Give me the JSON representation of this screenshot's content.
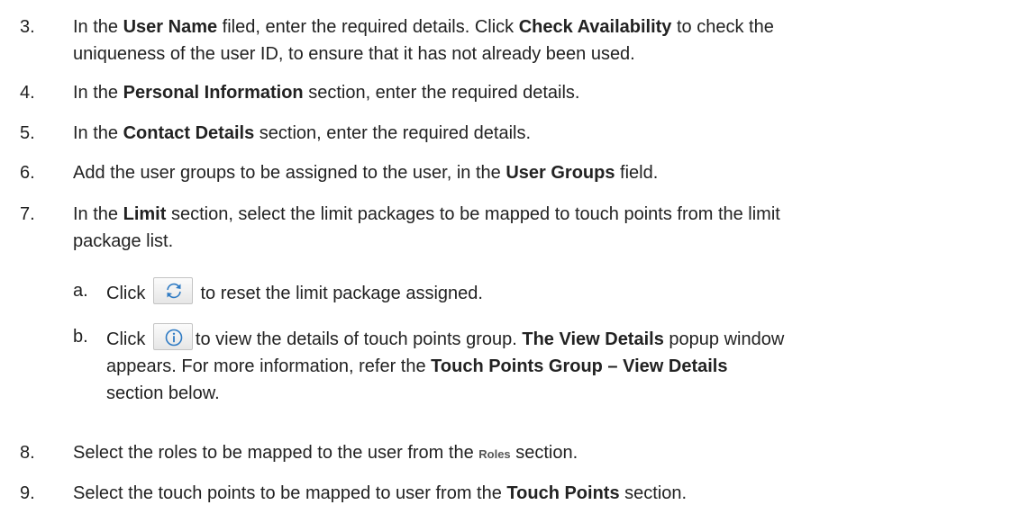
{
  "steps": [
    {
      "num": "3.",
      "parts": [
        "In the ",
        "User Name",
        " filed, enter the required details. Click ",
        "Check Availability",
        " to check the",
        "uniqueness of the user ID, to ensure that it has not already been used."
      ]
    },
    {
      "num": "4.",
      "parts": [
        "In the ",
        "Personal Information",
        " section, enter the required details."
      ]
    },
    {
      "num": "5.",
      "parts": [
        "In the ",
        "Contact Details",
        " section, enter the required details."
      ]
    },
    {
      "num": "6.",
      "parts": [
        "Add the user groups to be assigned to the user, in the ",
        "User Groups",
        " field."
      ]
    },
    {
      "num": "7.",
      "parts": [
        "In the ",
        "Limit",
        " section, select the limit packages to be mapped to touch points from the limit",
        "package list."
      ]
    },
    {
      "num": "8.",
      "parts": [
        "Select the roles to be mapped to the user from the ",
        "Roles",
        " section."
      ]
    },
    {
      "num": "9.",
      "parts": [
        "Select the touch points to be mapped to user from the ",
        "Touch Points",
        " section."
      ]
    }
  ],
  "substeps": [
    {
      "letter": "a.",
      "before": "Click",
      "after": "to reset the limit package assigned.",
      "icon": "refresh-icon"
    },
    {
      "letter": "b.",
      "before": "Click",
      "parts": [
        "to view the details of touch points group. ",
        "The View Details",
        " popup window",
        "appears. For more information, refer the ",
        "Touch Points Group – View Details",
        "section below."
      ],
      "icon": "info-icon"
    }
  ],
  "colors": {
    "text": "#222222",
    "icon": "#2f7bc4",
    "roles": "#555555"
  }
}
